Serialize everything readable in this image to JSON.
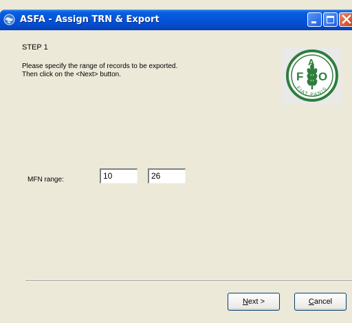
{
  "window": {
    "title": "ASFA - Assign TRN & Export",
    "controls": [
      "minimize",
      "maximize",
      "close"
    ]
  },
  "step_label": "STEP 1",
  "instructions": [
    "Please specify the range of records to be exported.",
    "Then click on the <Next> button."
  ],
  "logo": {
    "name": "FAO logo",
    "letters": [
      "F",
      "A",
      "O"
    ],
    "motto": "FIAT PANIS"
  },
  "mfn_range": {
    "label": "MFN range:",
    "from": "10",
    "to": "26"
  },
  "buttons": {
    "next": "Next >",
    "cancel": "Cancel"
  },
  "colors": {
    "titlebar": "#0553d8",
    "dialog_bg": "#ece9d8",
    "logo_green": "#2e7d3c"
  }
}
